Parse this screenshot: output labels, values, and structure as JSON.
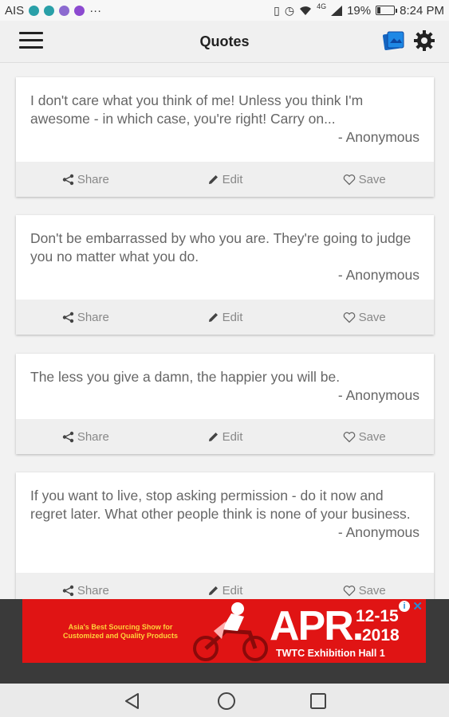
{
  "status_bar": {
    "carrier": "AIS",
    "network": "4G",
    "battery": "19%",
    "time": "8:24 PM",
    "more": "···"
  },
  "app_bar": {
    "title": "Quotes",
    "accent_color": "#1565c0"
  },
  "quotes": [
    {
      "text": "I don't care what you think of me! Unless you think I'm awesome - in which case, you're right! Carry on...",
      "author": "- Anonymous"
    },
    {
      "text": "Don't be embarrassed by who you are. They're going to judge you no matter what you do.",
      "author": "- Anonymous"
    },
    {
      "text": "The less you give a damn, the happier you will be.",
      "author": "- Anonymous"
    },
    {
      "text": "If you want to live, stop asking permission - do it now and regret later. What other people think is none of your business.",
      "author": "- Anonymous"
    }
  ],
  "actions": {
    "share": "Share",
    "edit": "Edit",
    "save": "Save"
  },
  "ad": {
    "tagline": "Asia's Best Sourcing Show for Customized and Quality Products",
    "month": "APR.",
    "dates": "12-15",
    "year": "2018",
    "venue": "TWTC Exhibition Hall 1",
    "info_label": "i",
    "close_label": "✕"
  }
}
